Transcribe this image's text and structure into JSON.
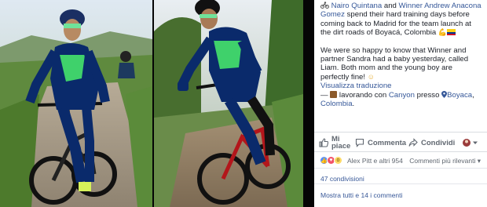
{
  "post": {
    "author_1": "Nairo Quintana",
    "text_and": " and ",
    "author_2": "Winner Andrew Anacona Gomez",
    "text_body": " spend their hard training days before coming back to Madrid for the team launch at the dirt roads of Boyacá, Colombia ",
    "paragraph_2": "We were so happy to know that Winner and partner Sandra had a baby yesterday, called Liam. Both mom and the young boy are perfectly fine! ",
    "translate_link": "Visualizza traduzione",
    "dash": "— ",
    "working_with": " lavorando con ",
    "company": "Canyon",
    "at": " presso ",
    "place": "Boyaca",
    "country": "Colombia",
    "punct_comma": ", ",
    "punct_dot": "."
  },
  "actions": {
    "like": "Mi piace",
    "like_line1": "Mi",
    "like_line2": "piace",
    "comment": "Commenta",
    "share": "Condividi"
  },
  "reactions": {
    "names": "Alex Pitt e altri 954",
    "sort": "Commenti più rilevanti ▾"
  },
  "shares": "47 condivisioni",
  "comments_link": "Mostra tutti e 14 i commenti",
  "colors": {
    "link": "#365899",
    "text": "#1d2129",
    "muted": "#606770",
    "jersey": "#0a2a6b",
    "jersey_accent": "#3fd16b"
  }
}
